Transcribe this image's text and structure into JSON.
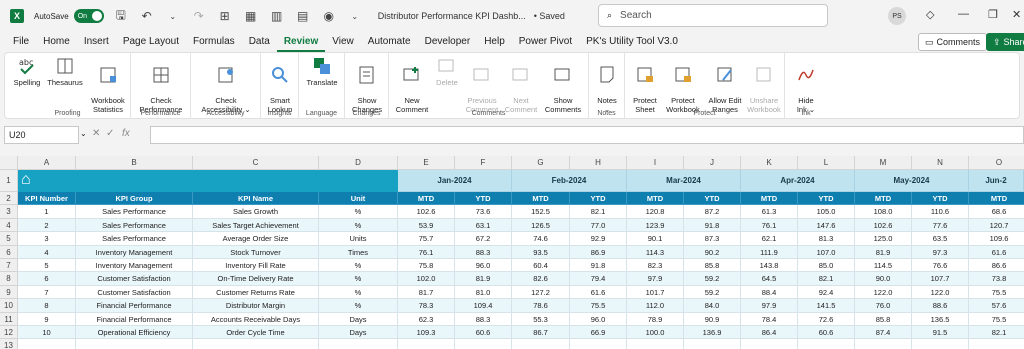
{
  "titlebar": {
    "app_logo": "X",
    "autosave_label": "AutoSave",
    "autosave_state": "On",
    "doc_title": "Distributor Performance KPI Dashb...",
    "saved_status": "• Saved",
    "search_placeholder": "Search",
    "avatar_initials": "PS"
  },
  "menu": {
    "items": [
      "File",
      "Home",
      "Insert",
      "Page Layout",
      "Formulas",
      "Data",
      "Review",
      "View",
      "Automate",
      "Developer",
      "Help",
      "Power Pivot",
      "PK's Utility Tool V3.0"
    ],
    "active": "Review",
    "comments_button": "Comments",
    "share_button": "Share"
  },
  "ribbon": {
    "groups": [
      {
        "label": "Proofing",
        "buttons": [
          "Spelling",
          "Thesaurus",
          "Workbook\nStatistics"
        ]
      },
      {
        "label": "Performance",
        "buttons": [
          "Check\nPerformance"
        ]
      },
      {
        "label": "Accessibility",
        "buttons": [
          "Check\nAccessibility ⌄"
        ]
      },
      {
        "label": "Insights",
        "buttons": [
          "Smart\nLookup"
        ]
      },
      {
        "label": "Language",
        "buttons": [
          "Translate"
        ]
      },
      {
        "label": "Changes",
        "buttons": [
          "Show\nChanges"
        ]
      },
      {
        "label": "Comments",
        "buttons": [
          "New\nComment",
          "Delete",
          "Previous\nComment",
          "Next\nComment",
          "Show\nComments"
        ]
      },
      {
        "label": "Notes",
        "buttons": [
          "Notes\n⌄"
        ]
      },
      {
        "label": "Protect",
        "buttons": [
          "Protect\nSheet",
          "Protect\nWorkbook",
          "Allow Edit\nRanges",
          "Unshare\nWorkbook"
        ]
      },
      {
        "label": "Ink",
        "buttons": [
          "Hide\nInk ⌄"
        ]
      }
    ],
    "disabled_buttons": [
      "Delete",
      "Previous\nComment",
      "Next\nComment",
      "Unshare\nWorkbook"
    ]
  },
  "formula_bar": {
    "name_box": "U20",
    "fx_label": "fx",
    "content": ""
  },
  "sheet": {
    "column_letters": [
      "A",
      "B",
      "C",
      "D",
      "E",
      "F",
      "G",
      "H",
      "I",
      "J",
      "K",
      "L",
      "M",
      "N",
      "O"
    ],
    "row_numbers": [
      "1",
      "2",
      "3",
      "4",
      "5",
      "6",
      "7",
      "8",
      "9",
      "10",
      "11",
      "12",
      "13"
    ],
    "months": [
      "Jan-2024",
      "Feb-2024",
      "Mar-2024",
      "Apr-2024",
      "May-2024",
      "Jun-2"
    ],
    "headers": [
      "KPI Number",
      "KPI Group",
      "KPI Name",
      "Unit",
      "MTD",
      "YTD",
      "MTD",
      "YTD",
      "MTD",
      "YTD",
      "MTD",
      "YTD",
      "MTD",
      "YTD",
      "MTD"
    ],
    "rows": [
      [
        "1",
        "Sales Performance",
        "Sales Growth",
        "%",
        "102.6",
        "73.6",
        "152.5",
        "82.1",
        "120.8",
        "87.2",
        "61.3",
        "105.0",
        "108.0",
        "110.6",
        "68.6"
      ],
      [
        "2",
        "Sales Performance",
        "Sales Target Achievement",
        "%",
        "53.9",
        "63.1",
        "126.5",
        "77.0",
        "123.9",
        "91.8",
        "76.1",
        "147.6",
        "102.6",
        "77.6",
        "120.7"
      ],
      [
        "3",
        "Sales Performance",
        "Average Order Size",
        "Units",
        "75.7",
        "67.2",
        "74.6",
        "92.9",
        "90.1",
        "87.3",
        "62.1",
        "81.3",
        "125.0",
        "63.5",
        "109.6"
      ],
      [
        "4",
        "Inventory Management",
        "Stock Turnover",
        "Times",
        "76.1",
        "88.3",
        "93.5",
        "86.9",
        "114.3",
        "90.2",
        "111.9",
        "107.0",
        "81.9",
        "97.3",
        "61.6"
      ],
      [
        "5",
        "Inventory Management",
        "Inventory Fill Rate",
        "%",
        "75.8",
        "96.0",
        "60.4",
        "91.8",
        "82.3",
        "85.8",
        "143.8",
        "85.0",
        "114.5",
        "76.6",
        "86.6"
      ],
      [
        "6",
        "Customer Satisfaction",
        "On-Time Delivery Rate",
        "%",
        "102.0",
        "81.9",
        "82.6",
        "79.4",
        "97.9",
        "59.2",
        "64.5",
        "82.1",
        "90.0",
        "107.7",
        "73.8"
      ],
      [
        "7",
        "Customer Satisfaction",
        "Customer Returns Rate",
        "%",
        "81.7",
        "81.0",
        "127.2",
        "61.6",
        "101.7",
        "59.2",
        "88.4",
        "92.4",
        "122.0",
        "122.0",
        "75.5"
      ],
      [
        "8",
        "Financial Performance",
        "Distributor Margin",
        "%",
        "78.3",
        "109.4",
        "78.6",
        "75.5",
        "112.0",
        "84.0",
        "97.9",
        "141.5",
        "76.0",
        "88.6",
        "57.6"
      ],
      [
        "9",
        "Financial Performance",
        "Accounts Receivable Days",
        "Days",
        "62.3",
        "88.3",
        "55.3",
        "96.0",
        "78.9",
        "90.9",
        "78.4",
        "72.6",
        "85.8",
        "136.5",
        "75.5"
      ],
      [
        "10",
        "Operational Efficiency",
        "Order Cycle Time",
        "Days",
        "109.3",
        "60.6",
        "86.7",
        "66.9",
        "100.0",
        "136.9",
        "86.4",
        "60.6",
        "87.4",
        "91.5",
        "82.1"
      ]
    ],
    "colors": {
      "banner": "#17a2c4",
      "month_band": "#bfe3ef",
      "header_row": "#0f7fb0",
      "row_even": "#ffffff",
      "row_odd": "#e9f6fa"
    }
  }
}
